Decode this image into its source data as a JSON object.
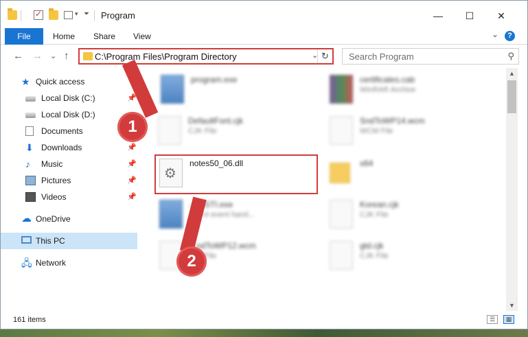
{
  "window": {
    "title": "Program",
    "minimize": "—",
    "maximize": "☐",
    "close": "✕"
  },
  "ribbon": {
    "file": "File",
    "home": "Home",
    "share": "Share",
    "view": "View",
    "help": "?"
  },
  "nav": {
    "back": "←",
    "forward": "→",
    "recent": "⌄",
    "up": "↑",
    "address": "C:\\Program Files\\Program Directory",
    "search_placeholder": "Search Program"
  },
  "sidebar": {
    "items": [
      {
        "label": "Quick access"
      },
      {
        "label": "Local Disk (C:)"
      },
      {
        "label": "Local Disk (D:)"
      },
      {
        "label": "Documents"
      },
      {
        "label": "Downloads"
      },
      {
        "label": "Music"
      },
      {
        "label": "Pictures"
      },
      {
        "label": "Videos"
      },
      {
        "label": "OneDrive"
      },
      {
        "label": "This PC"
      },
      {
        "label": "Network"
      }
    ]
  },
  "files": [
    {
      "name": "program.exe",
      "type": ""
    },
    {
      "name": "certificates.cab",
      "type": "WinRAR Archive"
    },
    {
      "name": "DefaultFont.cjk",
      "type": "CJK File"
    },
    {
      "name": "SndToWP14.wcm",
      "type": "WCM File"
    },
    {
      "name": "notes50_06.dll",
      "type": ""
    },
    {
      "name": "x64",
      "type": ""
    },
    {
      "name": "...yySTI.exe",
      "type": "...Y vt event hand..."
    },
    {
      "name": "Korean.cjk",
      "type": "CJK File"
    },
    {
      "name": "...ndToWP12.wcm",
      "type": "...M File"
    },
    {
      "name": "gtd.cjk",
      "type": "CJK File"
    }
  ],
  "status": {
    "count": "161 items"
  },
  "annotations": {
    "step1": "1",
    "step2": "2"
  },
  "colors": {
    "accent": "#1a75d2",
    "highlight": "#d23b3b",
    "selected": "#cce4f7"
  }
}
